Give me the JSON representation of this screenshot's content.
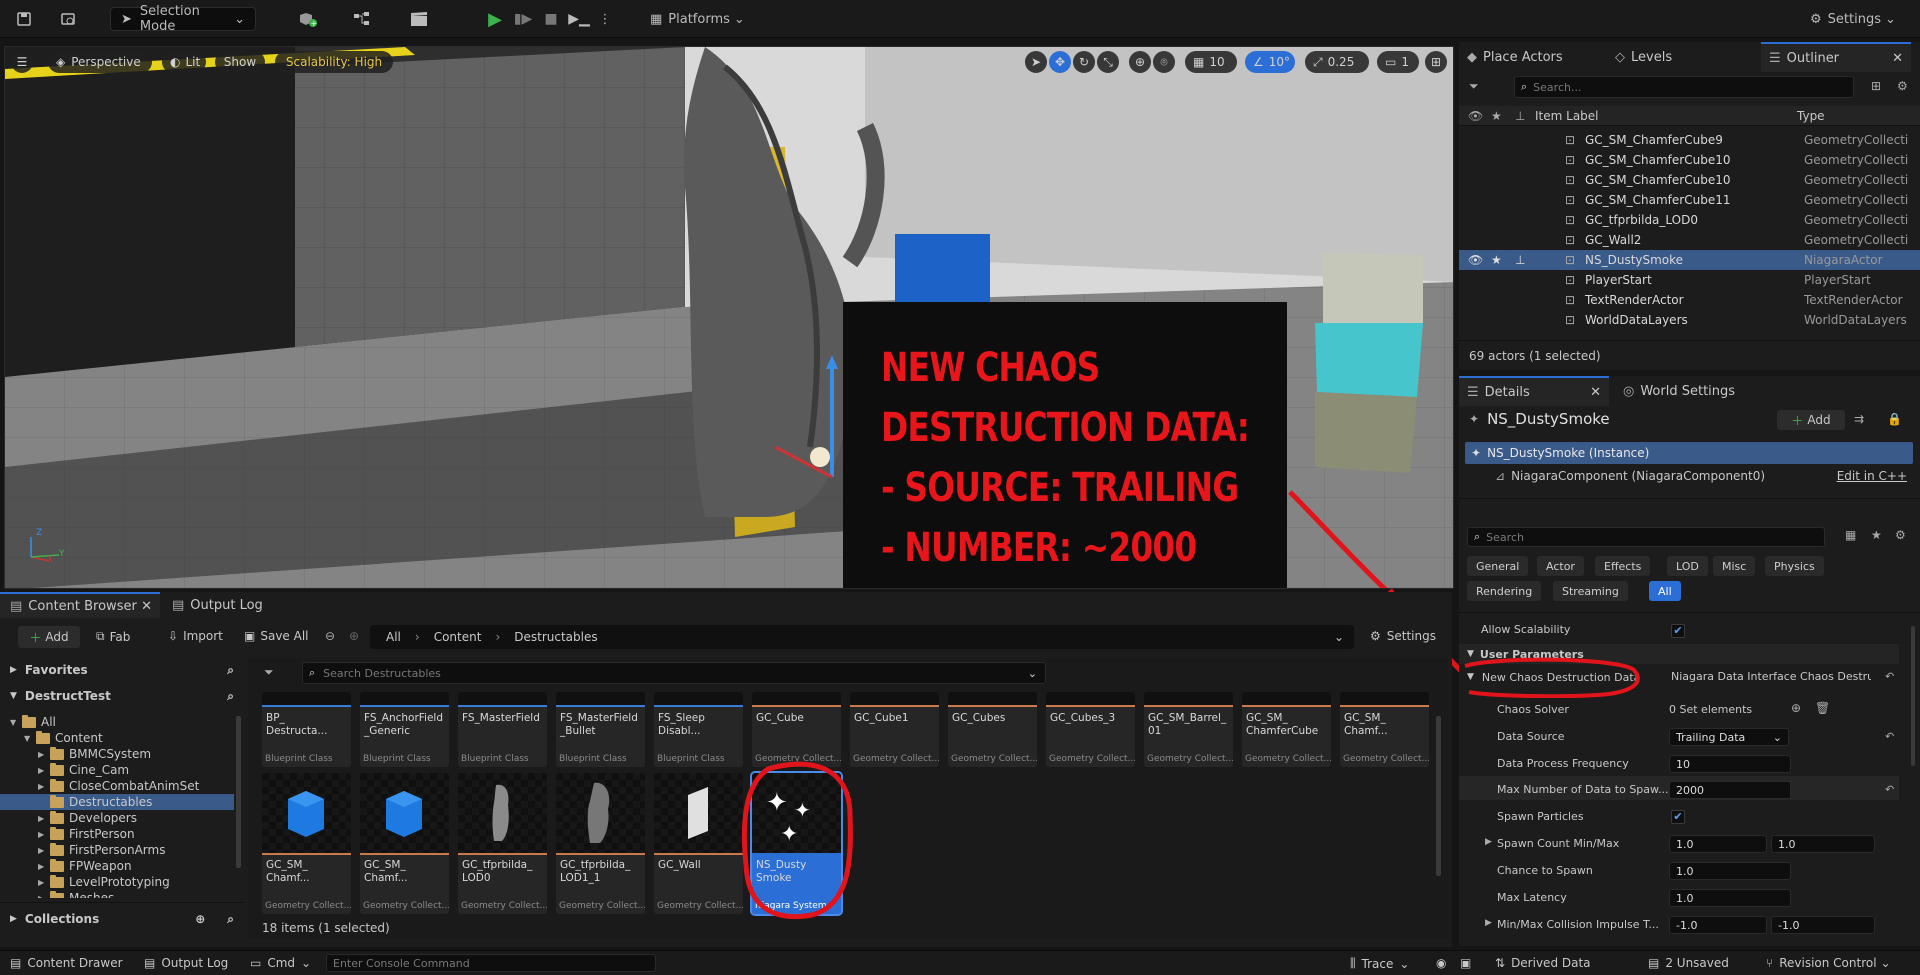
{
  "toolbar": {
    "mode_label": "Selection Mode",
    "platforms_label": "Platforms",
    "settings_label": "Settings"
  },
  "viewport": {
    "perspective_label": "Perspective",
    "lit_label": "Lit",
    "show_label": "Show",
    "scalability_label": "Scalability: High",
    "grid_value": "10",
    "rotation_value": "10°",
    "scale_value": "0.25",
    "camera_speed": "1",
    "axis_z": "Z",
    "axis_x": "X",
    "axis_y": "Y",
    "overlay_lines": [
      "NEW CHAOS",
      "DESTRUCTION DATA:",
      "- SOURCE: TRAILING",
      "- NUMBER: ~2000"
    ],
    "annotation_color": "#e0141a"
  },
  "outliner": {
    "tabs": [
      "Place Actors",
      "Levels",
      "Outliner"
    ],
    "search_placeholder": "Search...",
    "col_label": "Item Label",
    "col_type": "Type",
    "rows": [
      {
        "label": "GC_SM_ChamferCube9",
        "type": "GeometryCollecti"
      },
      {
        "label": "GC_SM_ChamferCube10",
        "type": "GeometryCollecti"
      },
      {
        "label": "GC_SM_ChamferCube10",
        "type": "GeometryCollecti"
      },
      {
        "label": "GC_SM_ChamferCube11",
        "type": "GeometryCollecti"
      },
      {
        "label": "GC_tfprbilda_LOD0",
        "type": "GeometryCollecti"
      },
      {
        "label": "GC_Wall2",
        "type": "GeometryCollecti"
      },
      {
        "label": "NS_DustySmoke",
        "type": "NiagaraActor"
      },
      {
        "label": "PlayerStart",
        "type": "PlayerStart"
      },
      {
        "label": "TextRenderActor",
        "type": "TextRenderActor"
      },
      {
        "label": "WorldDataLayers",
        "type": "WorldDataLayers"
      }
    ],
    "footer": "69 actors (1 selected)"
  },
  "details": {
    "tabs": [
      "Details",
      "World Settings"
    ],
    "actor_name": "NS_DustySmoke",
    "add_label": "Add",
    "instance_label": "NS_DustySmoke (Instance)",
    "component_label": "NiagaraComponent (NiagaraComponent0)",
    "edit_cpp": "Edit in C++",
    "search_placeholder": "Search",
    "categories": [
      "General",
      "Actor",
      "Effects",
      "LOD",
      "Misc",
      "Physics",
      "Rendering",
      "Streaming",
      "All"
    ],
    "allow_scalability": "Allow Scalability",
    "user_params": "User Parameters",
    "new_chaos_label": "New Chaos Destruction Data",
    "new_chaos_value": "Niagara Data Interface Chaos Destructi",
    "chaos_solver": "Chaos Solver",
    "set_elements": "0 Set elements",
    "data_source": "Data Source",
    "data_source_value": "Trailing Data",
    "data_process_freq": "Data Process Frequency",
    "data_process_freq_value": "10",
    "max_number": "Max Number of Data to Spaw...",
    "max_number_value": "2000",
    "spawn_particles": "Spawn Particles",
    "spawn_count": "Spawn Count Min/Max",
    "spawn_count_min": "1.0",
    "spawn_count_max": "1.0",
    "chance_to_spawn": "Chance to Spawn",
    "chance_value": "1.0",
    "max_latency": "Max Latency",
    "max_latency_value": "1.0",
    "min_max_collision": "Min/Max Collision Impulse T...",
    "collision_min": "-1.0",
    "collision_max": "-1.0"
  },
  "content_browser": {
    "tabs": [
      "Content Browser",
      "Output Log"
    ],
    "add_label": "Add",
    "fab_label": "Fab",
    "import_label": "Import",
    "save_all_label": "Save All",
    "breadcrumb": [
      "All",
      "Content",
      "Destructables"
    ],
    "settings_label": "Settings",
    "favorites": "Favorites",
    "project": "DestructTest",
    "tree": [
      "All",
      "Content",
      "BMMCSystem",
      "Cine_Cam",
      "CloseCombatAnimSet",
      "Destructables",
      "Developers",
      "FirstPerson",
      "FirstPersonArms",
      "FPWeapon",
      "LevelPrototyping",
      "Meshes"
    ],
    "collections": "Collections",
    "search_placeholder": "Search Destructables",
    "top_row": [
      {
        "name": "BP_\nDestructa...",
        "type": "Blueprint Class"
      },
      {
        "name": "FS_AnchorField\n_Generic",
        "type": "Blueprint Class"
      },
      {
        "name": "FS_MasterField",
        "type": "Blueprint Class"
      },
      {
        "name": "FS_MasterField\n_Bullet",
        "type": "Blueprint Class"
      },
      {
        "name": "FS_Sleep\nDisabl...",
        "type": "Blueprint Class"
      },
      {
        "name": "GC_Cube",
        "type": "Geometry Collect..."
      },
      {
        "name": "GC_Cube1",
        "type": "Geometry Collect..."
      },
      {
        "name": "GC_Cubes",
        "type": "Geometry Collect..."
      },
      {
        "name": "GC_Cubes_3",
        "type": "Geometry Collect..."
      },
      {
        "name": "GC_SM_Barrel_\n01",
        "type": "Geometry Collect..."
      },
      {
        "name": "GC_SM_\nChamferCube",
        "type": "Geometry Collect..."
      },
      {
        "name": "GC_SM_\nChamf...",
        "type": "Geometry Collect..."
      }
    ],
    "bottom_row": [
      {
        "name": "GC_SM_\nChamf...",
        "type": "Geometry Collect..."
      },
      {
        "name": "GC_SM_\nChamf...",
        "type": "Geometry Collect..."
      },
      {
        "name": "GC_tfprbilda_\nLOD0",
        "type": "Geometry Collect..."
      },
      {
        "name": "GC_tfprbilda_\nLOD1_1",
        "type": "Geometry Collect..."
      },
      {
        "name": "GC_Wall",
        "type": "Geometry Collect..."
      },
      {
        "name": "NS_Dusty\nSmoke",
        "type": "Niagara System"
      }
    ],
    "item_count": "18 items (1 selected)"
  },
  "statusbar": {
    "content_drawer": "Content Drawer",
    "output_log": "Output Log",
    "cmd": "Cmd",
    "console_placeholder": "Enter Console Command",
    "trace": "Trace",
    "derived_data": "Derived Data",
    "unsaved": "2 Unsaved",
    "revision_control": "Revision Control"
  }
}
